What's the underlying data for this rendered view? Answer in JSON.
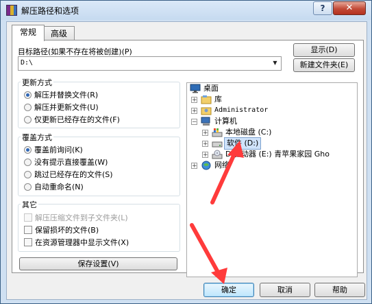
{
  "window": {
    "title": "解压路径和选项",
    "help_label": "?",
    "close_label": "✕"
  },
  "tabs": [
    {
      "label": "常规",
      "active": true
    },
    {
      "label": "高级",
      "active": false
    }
  ],
  "path": {
    "label": "目标路径(如果不存在将被创建)(P)",
    "value": "D:\\",
    "show_button": "显示(D)",
    "new_folder_button": "新建文件夹(E)"
  },
  "update_mode": {
    "title": "更新方式",
    "options": [
      {
        "label": "解压并替换文件(R)",
        "selected": true
      },
      {
        "label": "解压并更新文件(U)",
        "selected": false
      },
      {
        "label": "仅更新已经存在的文件(F)",
        "selected": false
      }
    ]
  },
  "overwrite_mode": {
    "title": "覆盖方式",
    "options": [
      {
        "label": "覆盖前询问(K)",
        "selected": true
      },
      {
        "label": "没有提示直接覆盖(W)",
        "selected": false
      },
      {
        "label": "跳过已经存在的文件(S)",
        "selected": false
      },
      {
        "label": "自动重命名(N)",
        "selected": false
      }
    ]
  },
  "misc": {
    "title": "其它",
    "options": [
      {
        "label": "解压压缩文件到子文件夹(L)",
        "checked": false,
        "disabled": true
      },
      {
        "label": "保留损坏的文件(B)",
        "checked": false,
        "disabled": false
      },
      {
        "label": "在资源管理器中显示文件(X)",
        "checked": false,
        "disabled": false
      }
    ]
  },
  "save_button": "保存设置(V)",
  "tree": {
    "items": [
      {
        "label": "桌面",
        "icon": "desktop-icon",
        "expander": ""
      },
      {
        "label": "库",
        "icon": "library-icon",
        "expander": "+"
      },
      {
        "label": "Administrator",
        "icon": "user-icon",
        "expander": "+"
      },
      {
        "label": "计算机",
        "icon": "computer-icon",
        "expander": "−"
      },
      {
        "label": "本地磁盘 (C:)",
        "icon": "drive-c-icon",
        "expander": "+"
      },
      {
        "label": "软件 (D:)",
        "icon": "drive-icon",
        "expander": "+",
        "selected": true
      },
      {
        "label": "D 驱动器 (E:) 青苹果家园 Gho",
        "icon": "cd-drive-icon",
        "expander": "+"
      },
      {
        "label": "网络",
        "icon": "network-icon",
        "expander": "+"
      }
    ]
  },
  "footer": {
    "ok": "确定",
    "cancel": "取消",
    "help": "帮助"
  },
  "colors": {
    "annotation_arrow": "#ff3b3b",
    "selection": "#cfe3fb"
  }
}
